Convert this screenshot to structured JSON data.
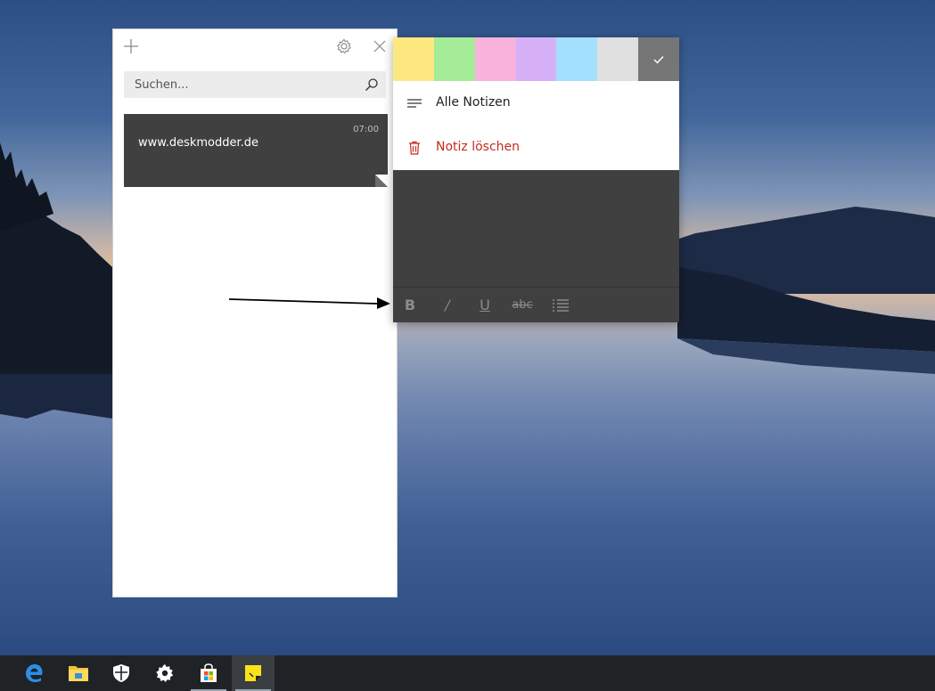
{
  "list_window": {
    "search": {
      "placeholder": "Suchen..."
    },
    "note": {
      "time": "07:00",
      "text": "www.deskmodder.de"
    }
  },
  "note_window": {
    "colors": [
      {
        "name": "yellow",
        "hex": "#fde87f"
      },
      {
        "name": "green",
        "hex": "#a4ec97"
      },
      {
        "name": "pink",
        "hex": "#f8b3dc"
      },
      {
        "name": "purple",
        "hex": "#d7b1f8"
      },
      {
        "name": "blue",
        "hex": "#a3e0fd"
      },
      {
        "name": "gray",
        "hex": "#e0e0e0"
      },
      {
        "name": "charcoal",
        "hex": "#767676",
        "selected": true
      }
    ],
    "menu": {
      "all_notes": "Alle Notizen",
      "delete_note": "Notiz löschen",
      "delete_color": "#c42b1c"
    },
    "format": {
      "bold": "B",
      "italic": "/",
      "underline": "U",
      "strikethrough": "abc"
    }
  },
  "taskbar": {
    "apps": [
      "edge-icon",
      "file-explorer-icon",
      "windows-defender-icon",
      "settings-icon",
      "store-icon",
      "sticky-notes-icon"
    ],
    "active": "sticky-notes-icon"
  }
}
